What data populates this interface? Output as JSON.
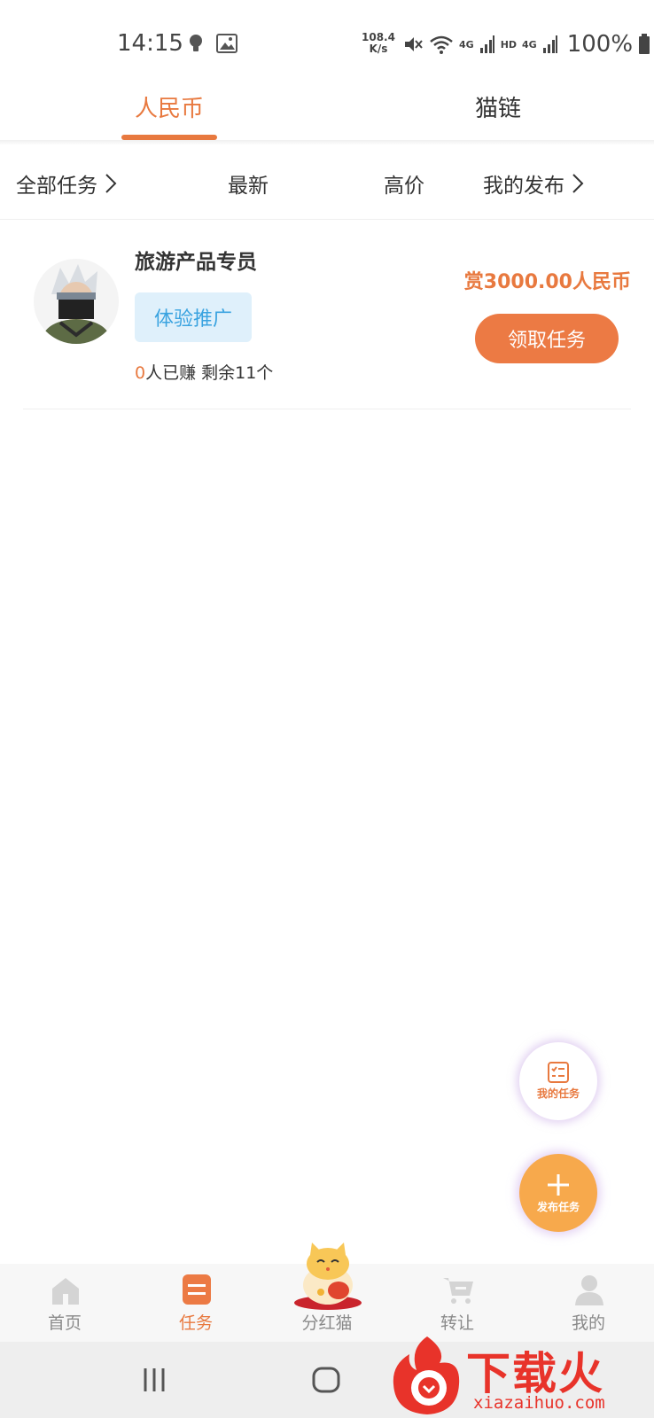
{
  "status": {
    "time": "14:15",
    "speed_value": "108.4",
    "speed_unit": "K/s",
    "net1": "4G",
    "hd": "HD",
    "net2": "4G",
    "battery": "100%"
  },
  "tabs": [
    {
      "label": "人民币",
      "active": true
    },
    {
      "label": "猫链",
      "active": false
    }
  ],
  "filters": {
    "all_tasks": "全部任务",
    "latest": "最新",
    "high_price": "高价",
    "my_posts": "我的发布"
  },
  "task": {
    "title": "旅游产品专员",
    "tag": "体验推广",
    "earned_count": "0",
    "earned_suffix": "人已赚 剩余11个",
    "reward": "赏3000.00人民币",
    "claim_label": "领取任务"
  },
  "fabs": {
    "my_tasks": "我的任务",
    "publish": "发布任务"
  },
  "bottom_nav": [
    {
      "label": "首页",
      "icon": "home-icon"
    },
    {
      "label": "任务",
      "icon": "task-icon",
      "active": true
    },
    {
      "label": "分红猫",
      "icon": "lucky-cat-icon"
    },
    {
      "label": "转让",
      "icon": "cart-icon"
    },
    {
      "label": "我的",
      "icon": "user-icon"
    }
  ],
  "watermark": {
    "brand": "下载火",
    "url": "xiazaihuo.com"
  },
  "colors": {
    "accent": "#e8793f",
    "tag_bg": "#dff0fb",
    "tag_text": "#3aa3e0",
    "watermark": "#e8332a"
  }
}
